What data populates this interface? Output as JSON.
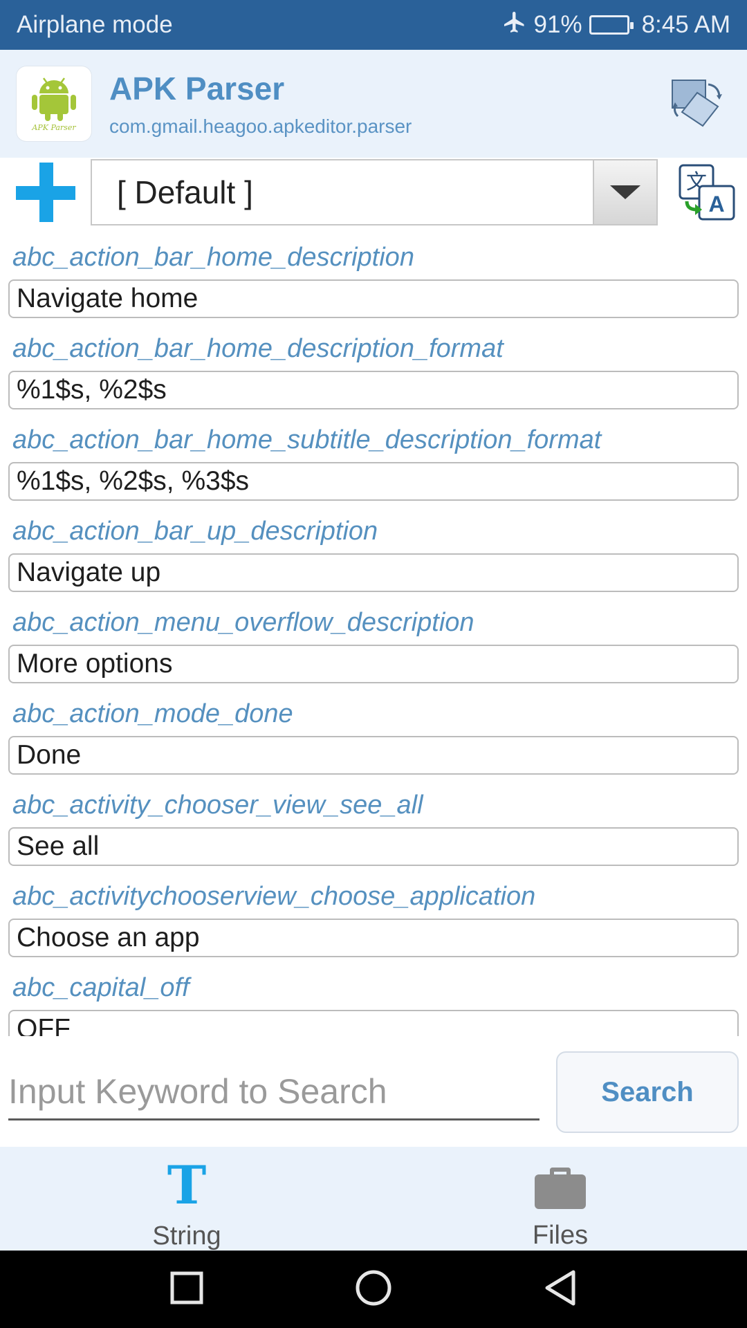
{
  "status_bar": {
    "mode": "Airplane mode",
    "battery": "91%",
    "time": "8:45 AM"
  },
  "app": {
    "title": "APK Parser",
    "package": "com.gmail.heagoo.apkeditor.parser",
    "logo_caption": "APK Parser"
  },
  "toolbar": {
    "locale_value": "[ Default ]"
  },
  "strings": [
    {
      "key": "abc_action_bar_home_description",
      "value": "Navigate home"
    },
    {
      "key": "abc_action_bar_home_description_format",
      "value": "%1$s, %2$s"
    },
    {
      "key": "abc_action_bar_home_subtitle_description_format",
      "value": "%1$s, %2$s, %3$s"
    },
    {
      "key": "abc_action_bar_up_description",
      "value": "Navigate up"
    },
    {
      "key": "abc_action_menu_overflow_description",
      "value": "More options"
    },
    {
      "key": "abc_action_mode_done",
      "value": "Done"
    },
    {
      "key": "abc_activity_chooser_view_see_all",
      "value": "See all"
    },
    {
      "key": "abc_activitychooserview_choose_application",
      "value": "Choose an app"
    },
    {
      "key": "abc_capital_off",
      "value": "OFF"
    }
  ],
  "search": {
    "placeholder": "Input Keyword to Search",
    "value": "",
    "button_label": "Search"
  },
  "tabs": [
    {
      "label": "String",
      "icon": "text-t-icon",
      "icon_glyph": "T"
    },
    {
      "label": "Files",
      "icon": "briefcase-icon"
    }
  ],
  "colors": {
    "status_bar": "#2a6199",
    "header_bg": "#eaf2fb",
    "accent_blue": "#1aa3e6",
    "key_text": "#5590bf"
  }
}
